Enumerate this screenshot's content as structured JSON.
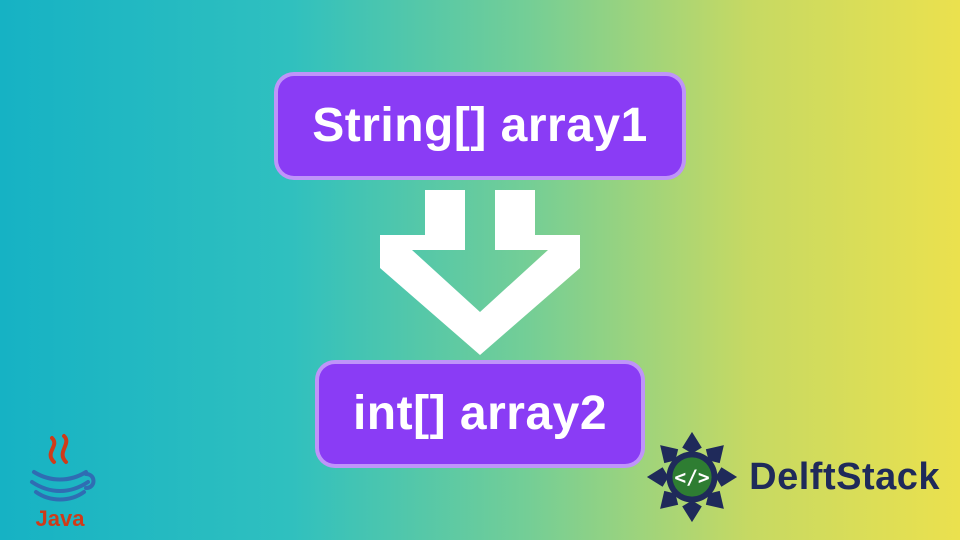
{
  "top_label": "String[] array1",
  "bottom_label": "int[] array2",
  "colors": {
    "pill_bg": "#8a3cf5",
    "pill_text": "#ffffff",
    "arrow": "#ffffff",
    "java_red": "#cf3b19",
    "java_blue": "#2f6db3",
    "delft_blue": "#1f2a5a",
    "delft_green": "#2e7d32"
  },
  "logos": {
    "java_text": "Java",
    "delft_text": "DelftStack"
  }
}
